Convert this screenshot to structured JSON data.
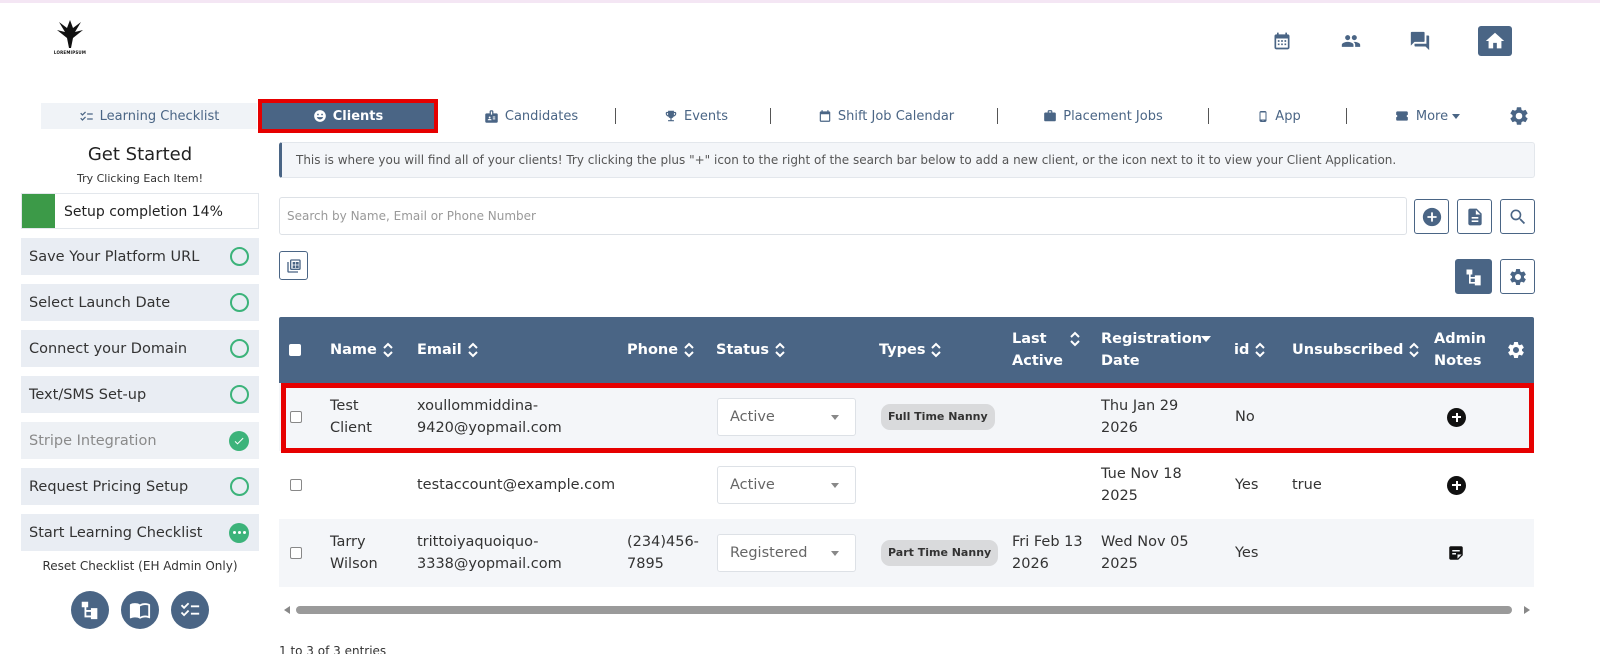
{
  "header": {
    "logo_text": "LOREMIPSUM",
    "icons": [
      "calendar-icon",
      "people-icon",
      "chat-icon",
      "home-icon"
    ]
  },
  "nav": {
    "tabs": [
      {
        "label": "Learning Checklist",
        "icon": "checklist-icon"
      },
      {
        "label": "Clients",
        "icon": "smile-icon",
        "active": true
      },
      {
        "label": "Candidates",
        "icon": "id-badge-icon"
      },
      {
        "label": "Events",
        "icon": "trophy-icon"
      },
      {
        "label": "Shift Job Calendar",
        "icon": "calendar-icon"
      },
      {
        "label": "Placement Jobs",
        "icon": "briefcase-icon"
      },
      {
        "label": "App",
        "icon": "phone-icon"
      },
      {
        "label": "More",
        "icon": "ticket-icon"
      }
    ]
  },
  "sidebar": {
    "title": "Get Started",
    "subtitle": "Try Clicking Each Item!",
    "progress": {
      "label": "Setup completion 14%",
      "percent": 14
    },
    "items": [
      {
        "label": "Save Your Platform URL",
        "state": "todo"
      },
      {
        "label": "Select Launch Date",
        "state": "todo"
      },
      {
        "label": "Connect your Domain",
        "state": "todo"
      },
      {
        "label": "Text/SMS Set-up",
        "state": "todo"
      },
      {
        "label": "Stripe Integration",
        "state": "done"
      },
      {
        "label": "Request Pricing Setup",
        "state": "todo"
      },
      {
        "label": "Start Learning Checklist",
        "state": "more"
      }
    ],
    "reset_label": "Reset Checklist (EH Admin Only)"
  },
  "main": {
    "info_text": "This is where you will find all of your clients! Try clicking the plus \"+\" icon to the right of the search bar below to add a new client, or the icon next to it to view your Client Application.",
    "search_placeholder": "Search by Name, Email or Phone Number",
    "entries_text": "1 to 3 of 3 entries"
  },
  "table": {
    "columns": [
      {
        "key": "name",
        "label": "Name"
      },
      {
        "key": "email",
        "label": "Email"
      },
      {
        "key": "phone",
        "label": "Phone"
      },
      {
        "key": "status",
        "label": "Status"
      },
      {
        "key": "types",
        "label": "Types"
      },
      {
        "key": "last_active",
        "label": "Last Active"
      },
      {
        "key": "registration_date",
        "label": "Registration Date"
      },
      {
        "key": "id",
        "label": "id"
      },
      {
        "key": "unsubscribed",
        "label": "Unsubscribed"
      },
      {
        "key": "admin_notes",
        "label": "Admin Notes"
      }
    ],
    "rows": [
      {
        "name": "Test Client",
        "email": "xoullommiddina-9420@yopmail.com",
        "phone": "",
        "status": "Active",
        "types": "Full Time Nanny",
        "last_active": "",
        "registration_date": "Thu Jan 29 2026",
        "id": "No",
        "unsubscribed": "",
        "admin_notes_icon": "plus-circle-icon"
      },
      {
        "name": "",
        "email": "testaccount@example.com",
        "phone": "",
        "status": "Active",
        "types": "",
        "last_active": "",
        "registration_date": "Tue Nov 18 2025",
        "id": "Yes",
        "unsubscribed": "true",
        "admin_notes_icon": "plus-circle-icon"
      },
      {
        "name": "Tarry Wilson",
        "email": "trittoiyaquoiquo-3338@yopmail.com",
        "phone": "(234)456-7895",
        "status": "Registered",
        "types": "Part Time Nanny",
        "last_active": "Fri Feb 13 2026",
        "registration_date": "Wed Nov 05 2025",
        "id": "Yes",
        "unsubscribed": "",
        "admin_notes_icon": "note-icon"
      }
    ]
  },
  "colors": {
    "primary": "#4a6585",
    "success": "#3cb37a",
    "highlight": "#e60000"
  }
}
